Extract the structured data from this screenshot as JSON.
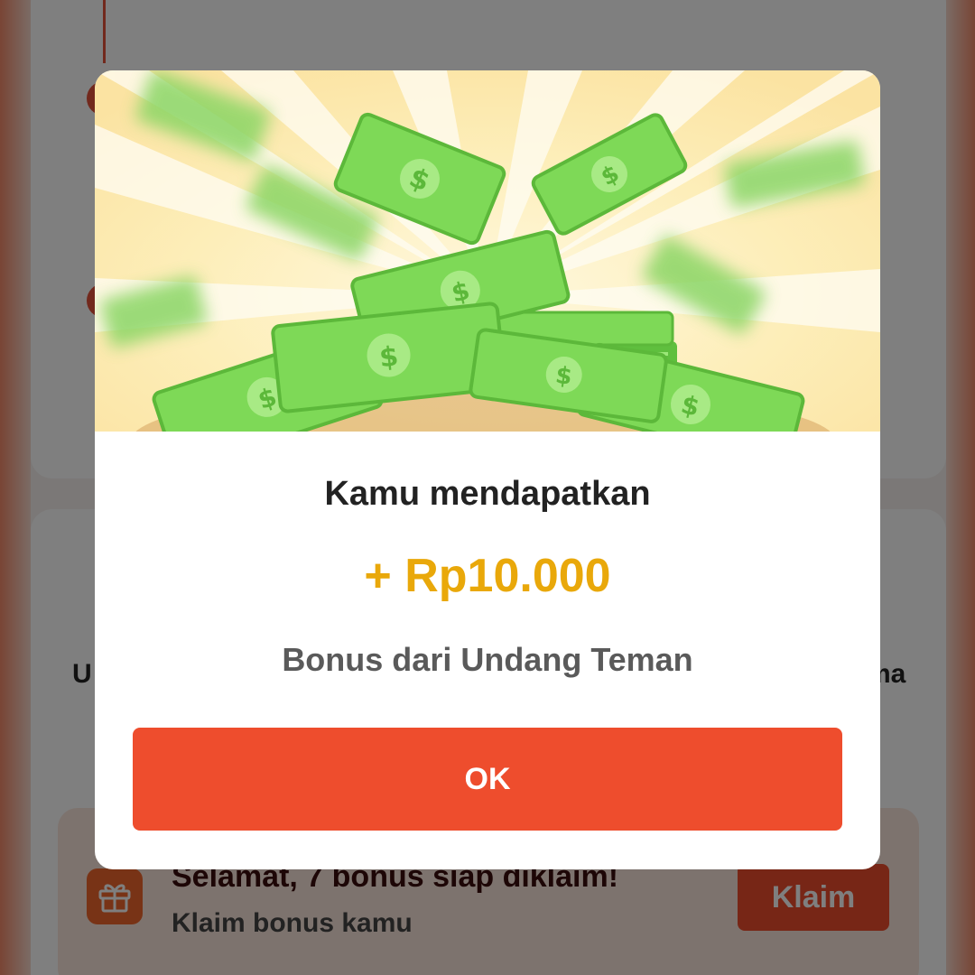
{
  "background": {
    "left_text_fragment": "U",
    "right_text_fragment": "ma",
    "bonus_banner": {
      "title": "Selamat, 7 bonus siap diklaim!",
      "subtitle": "Klaim bonus kamu",
      "button_label": "Klaim",
      "icon": "gift-icon"
    }
  },
  "modal": {
    "illustration": "money-pile-illustration",
    "title": "Kamu mendapatkan",
    "amount": "+ Rp10.000",
    "description": "Bonus dari Undang Teman",
    "ok_label": "OK"
  },
  "colors": {
    "accent": "#ee4d2d",
    "amount": "#e9a80a",
    "money_green": "#7ed957"
  }
}
